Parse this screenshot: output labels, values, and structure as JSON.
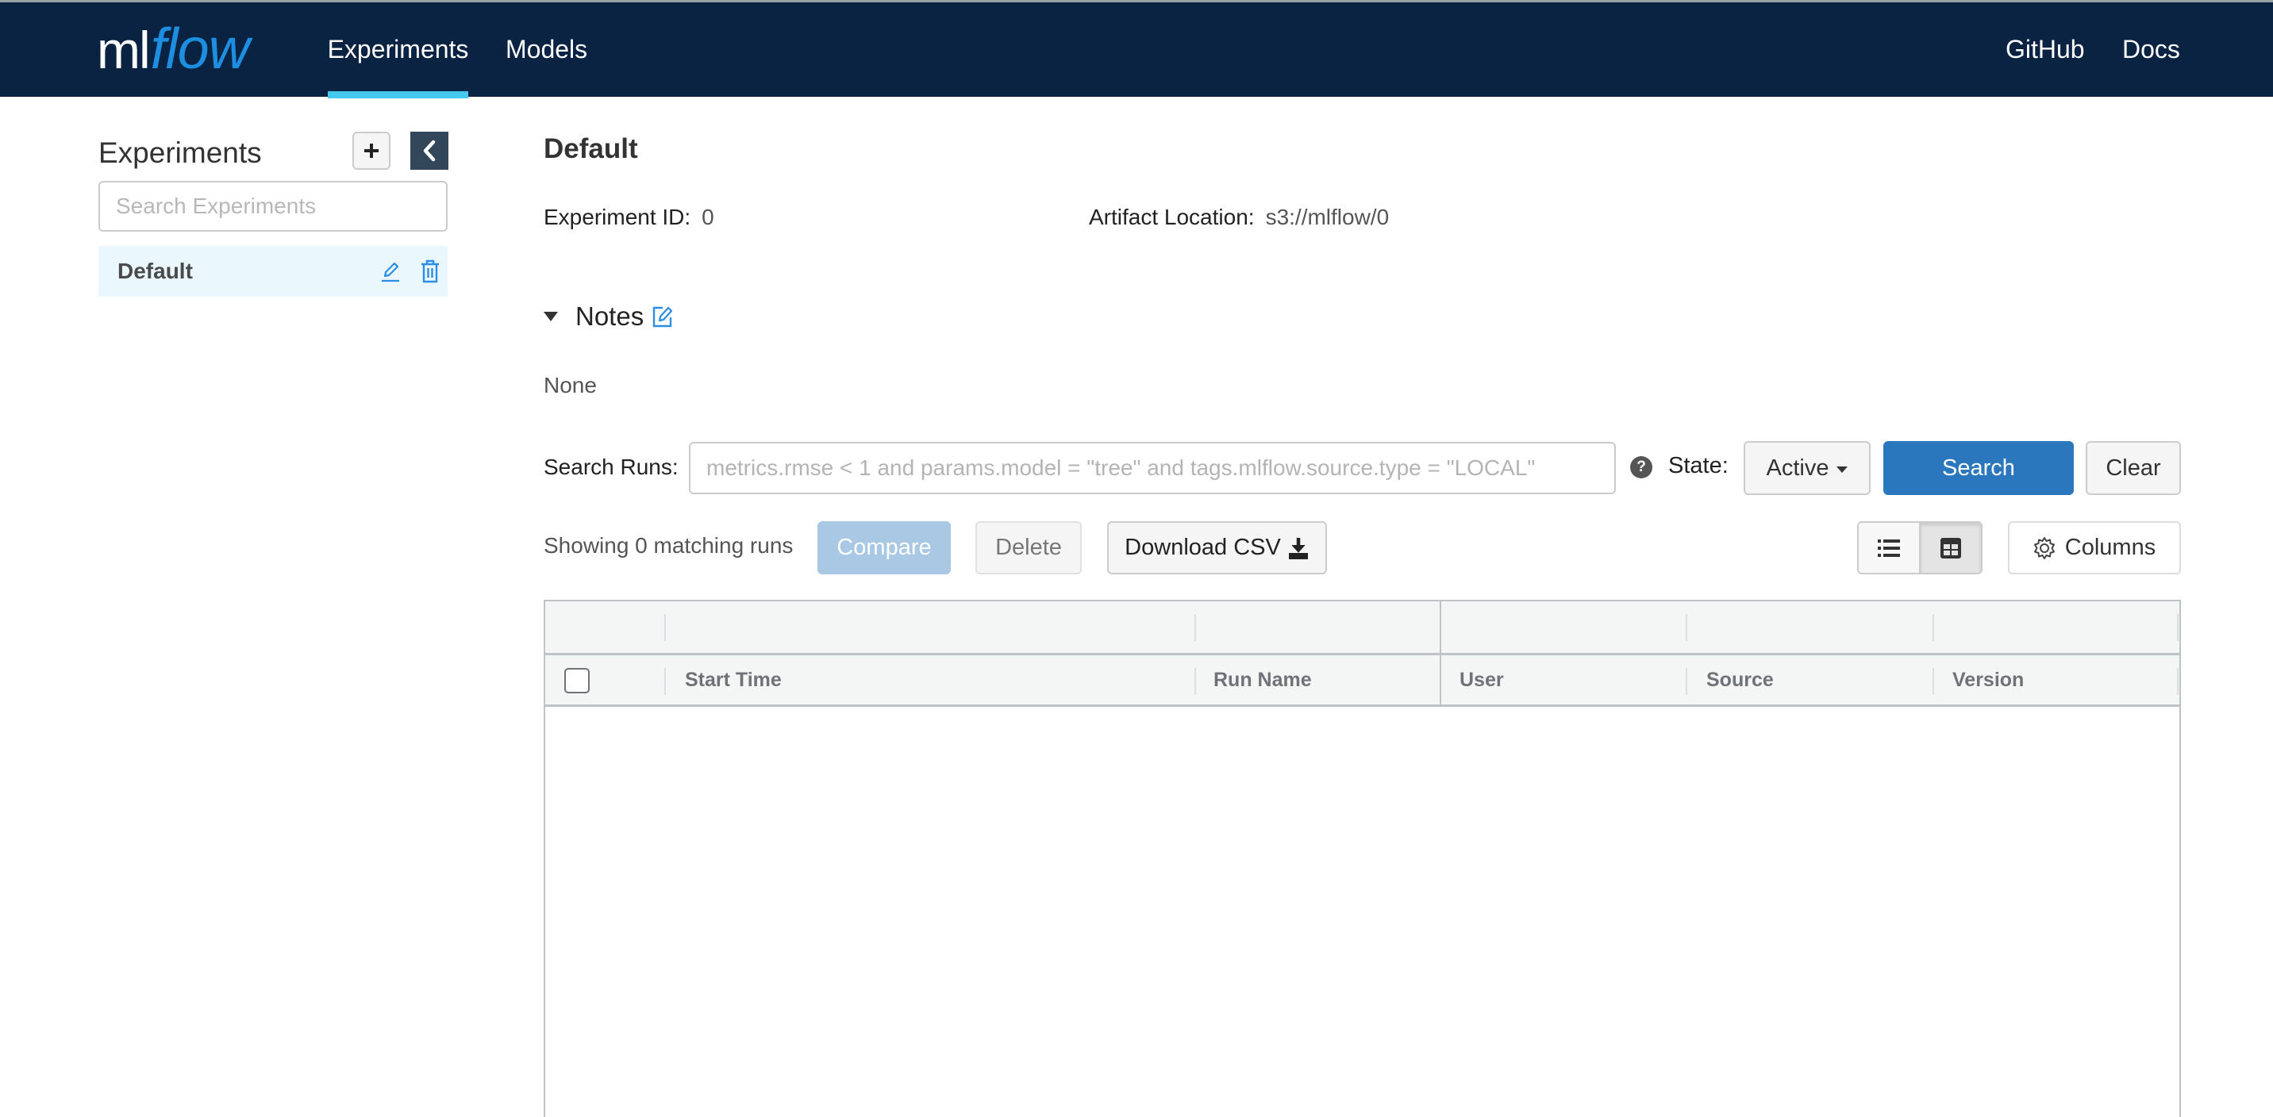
{
  "header": {
    "logo": {
      "part1": "ml",
      "part2": "flow"
    },
    "tabs": [
      {
        "label": "Experiments",
        "active": true
      },
      {
        "label": "Models",
        "active": false
      }
    ],
    "links": [
      {
        "label": "GitHub"
      },
      {
        "label": "Docs"
      }
    ],
    "colors": {
      "background": "#0b2343",
      "active_underline": "#43c9ed",
      "logo_accent": "#1d8fe1"
    }
  },
  "sidebar": {
    "title": "Experiments",
    "add_button_icon": "plus-icon",
    "collapse_button_icon": "chevron-left-icon",
    "search": {
      "placeholder": "Search Experiments",
      "value": ""
    },
    "experiments": [
      {
        "name": "Default",
        "selected": true
      }
    ]
  },
  "main": {
    "title": "Default",
    "experiment_id_label": "Experiment ID:",
    "experiment_id": "0",
    "artifact_location_label": "Artifact Location:",
    "artifact_location": "s3://mlflow/0",
    "notes": {
      "label": "Notes",
      "expanded": true,
      "content": "None"
    },
    "search_runs": {
      "label": "Search Runs:",
      "placeholder": "metrics.rmse < 1 and params.model = \"tree\" and tags.mlflow.source.type = \"LOCAL\"",
      "value": "",
      "help_icon": "?",
      "state_label": "State:",
      "state_value": "Active",
      "search_button": "Search",
      "clear_button": "Clear"
    },
    "toolbar": {
      "showing_text": "Showing 0 matching runs",
      "compare_button": "Compare",
      "delete_button": "Delete",
      "download_csv_button": "Download CSV",
      "view_modes": [
        {
          "name": "list-view",
          "active": false
        },
        {
          "name": "grid-view",
          "active": true
        }
      ],
      "columns_button": "Columns"
    },
    "table": {
      "columns": [
        "Start Time",
        "Run Name",
        "User",
        "Source",
        "Version"
      ],
      "rows": []
    },
    "colors": {
      "primary": "#2b77bd",
      "primary_disabled": "#a9c8e4",
      "selected_item_bg": "#eaf7fd"
    }
  }
}
